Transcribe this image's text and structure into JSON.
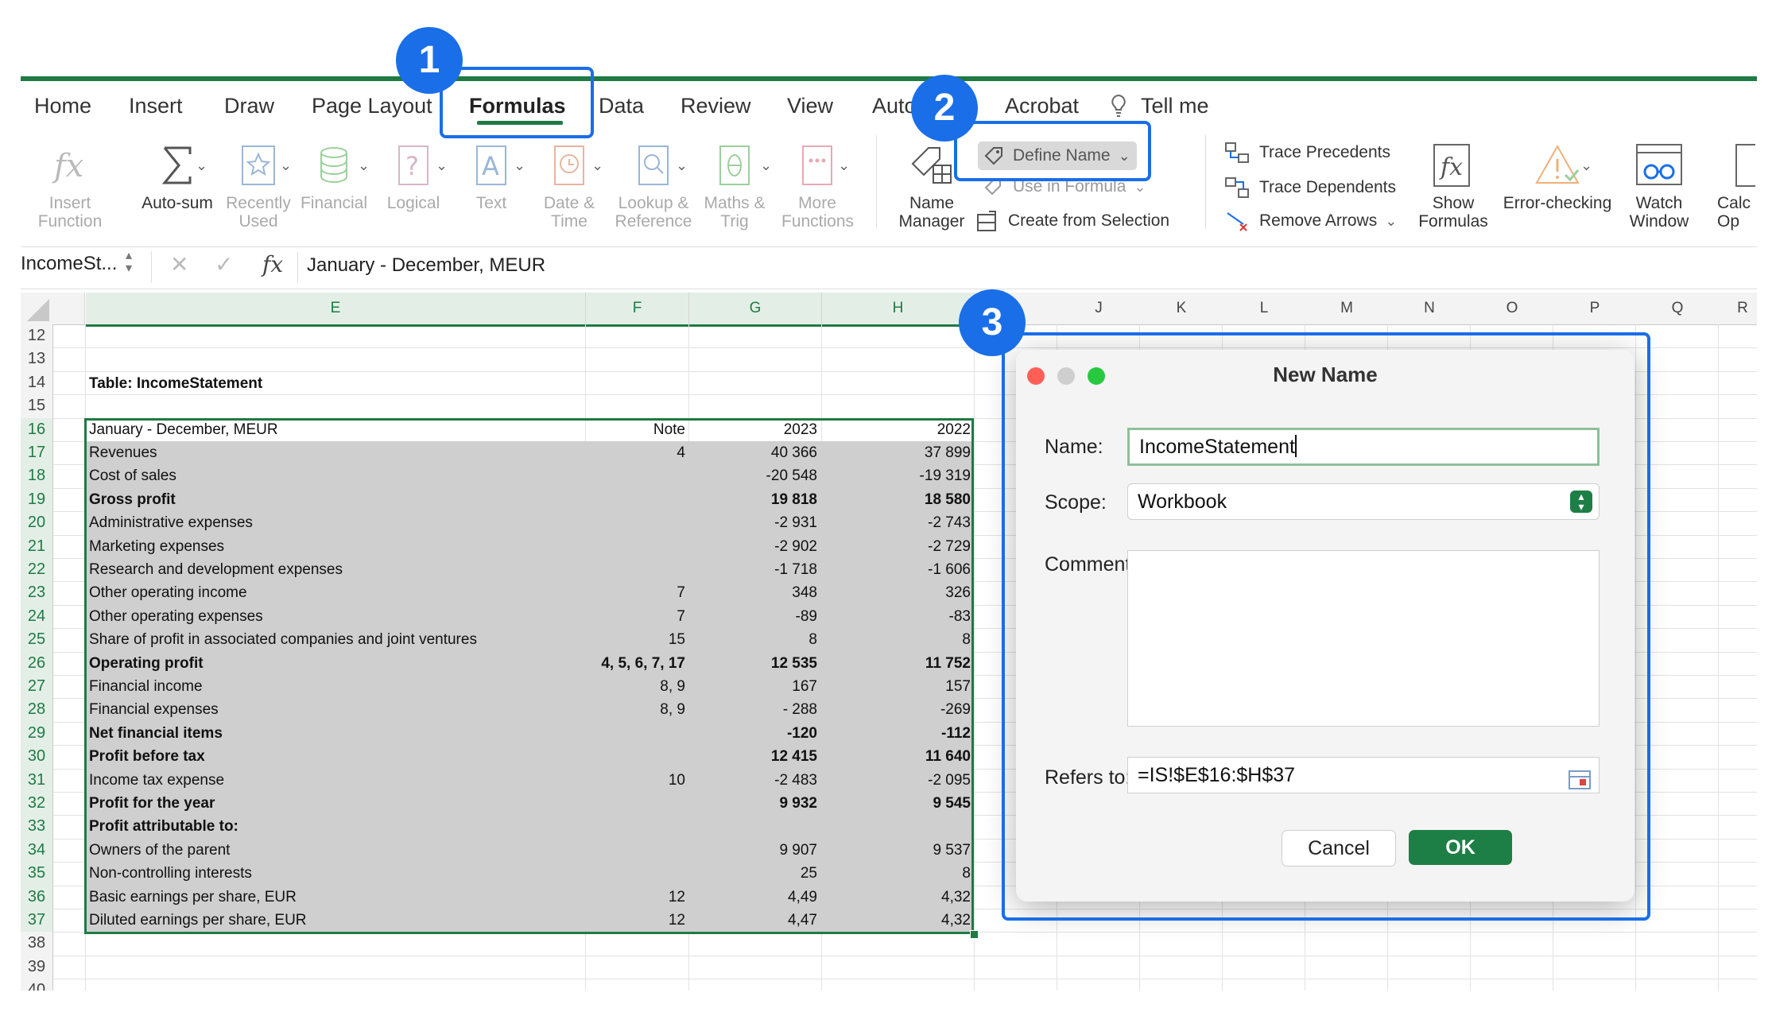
{
  "ribbon": {
    "tabs": [
      "Home",
      "Insert",
      "Draw",
      "Page Layout",
      "Formulas",
      "Data",
      "Review",
      "View",
      "Auto",
      "Acrobat",
      "Tell me"
    ],
    "buttons": {
      "insert_function": "Insert Function",
      "autosum": "Auto-sum",
      "recently_used": "Recently Used",
      "financial": "Financial",
      "logical": "Logical",
      "text": "Text",
      "date_time": "Date & Time",
      "lookup_reference": "Lookup & Reference",
      "maths_trig": "Maths & Trig",
      "more_functions": "More Functions",
      "name_manager": "Name Manager",
      "define_name": "Define Name",
      "use_in_formula": "Use in Formula",
      "create_from_selection": "Create from Selection",
      "trace_precedents": "Trace Precedents",
      "trace_dependents": "Trace Dependents",
      "remove_arrows": "Remove Arrows",
      "show_formulas": "Show Formulas",
      "error_checking": "Error-checking",
      "watch_window": "Watch Window",
      "calc_options": "Calc Op"
    }
  },
  "formula_bar": {
    "name_box": "IncomeSt...",
    "fx": "fx",
    "content": "January - December, MEUR"
  },
  "sheet": {
    "columns": [
      "E",
      "F",
      "G",
      "H",
      "J",
      "K",
      "L",
      "M",
      "N",
      "O",
      "P",
      "Q",
      "R"
    ],
    "rows": [
      "12",
      "13",
      "14",
      "15",
      "16",
      "17",
      "18",
      "19",
      "20",
      "21",
      "22",
      "23",
      "24",
      "25",
      "26",
      "27",
      "28",
      "29",
      "30",
      "31",
      "32",
      "33",
      "34",
      "35",
      "36",
      "37",
      "38",
      "39",
      "40"
    ],
    "table_title": "Table: IncomeStatement",
    "table_rows": [
      {
        "label": "January - December, MEUR",
        "note": "Note",
        "y2023": "2023",
        "y2022": "2022"
      },
      {
        "label": "Revenues",
        "note": "4",
        "y2023": "40 366",
        "y2022": "37 899"
      },
      {
        "label": "Cost of sales",
        "note": "",
        "y2023": "-20 548",
        "y2022": "-19 319"
      },
      {
        "label": "Gross profit",
        "note": "",
        "y2023": "19 818",
        "y2022": "18 580"
      },
      {
        "label": "Administrative expenses",
        "note": "",
        "y2023": "-2 931",
        "y2022": "-2 743"
      },
      {
        "label": "Marketing expenses",
        "note": "",
        "y2023": "-2 902",
        "y2022": "-2 729"
      },
      {
        "label": "Research and development expenses",
        "note": "",
        "y2023": "-1 718",
        "y2022": "-1 606"
      },
      {
        "label": "Other operating income",
        "note": "7",
        "y2023": "348",
        "y2022": "326"
      },
      {
        "label": "Other operating expenses",
        "note": "7",
        "y2023": "-89",
        "y2022": "-83"
      },
      {
        "label": "Share of profit in associated companies and joint ventures",
        "note": "15",
        "y2023": "8",
        "y2022": "8"
      },
      {
        "label": "Operating profit",
        "note": "4, 5, 6, 7, 17",
        "y2023": "12 535",
        "y2022": "11 752"
      },
      {
        "label": "Financial income",
        "note": "8, 9",
        "y2023": "167",
        "y2022": "157"
      },
      {
        "label": "Financial expenses",
        "note": "8, 9",
        "y2023": "- 288",
        "y2022": "-269"
      },
      {
        "label": "Net financial items",
        "note": "",
        "y2023": "-120",
        "y2022": "-112"
      },
      {
        "label": "Profit before tax",
        "note": "",
        "y2023": "12 415",
        "y2022": "11 640"
      },
      {
        "label": "Income tax expense",
        "note": "10",
        "y2023": "-2 483",
        "y2022": "-2 095"
      },
      {
        "label": "Profit for the year",
        "note": "",
        "y2023": "9 932",
        "y2022": "9 545"
      },
      {
        "label": "Profit attributable to:",
        "note": "",
        "y2023": "",
        "y2022": ""
      },
      {
        "label": "Owners of the parent",
        "note": "",
        "y2023": "9 907",
        "y2022": "9 537"
      },
      {
        "label": "Non-controlling interests",
        "note": "",
        "y2023": "25",
        "y2022": "8"
      },
      {
        "label": "Basic earnings per share, EUR",
        "note": "12",
        "y2023": "4,49",
        "y2022": "4,32"
      },
      {
        "label": "Diluted earnings per share, EUR",
        "note": "12",
        "y2023": "4,47",
        "y2022": "4,32"
      }
    ]
  },
  "dialog": {
    "title": "New Name",
    "name_label": "Name:",
    "name_value": "IncomeStatement",
    "scope_label": "Scope:",
    "scope_value": "Workbook",
    "comment_label": "Comment:",
    "comment_value": "",
    "refers_label": "Refers to:",
    "refers_value": "=IS!$E$16:$H$37",
    "cancel": "Cancel",
    "ok": "OK"
  },
  "callouts": [
    "1",
    "2",
    "3"
  ],
  "colors": {
    "accent_green": "#1f7a44",
    "callout_blue": "#1a6ee8",
    "ok_green": "#1e7f46"
  }
}
